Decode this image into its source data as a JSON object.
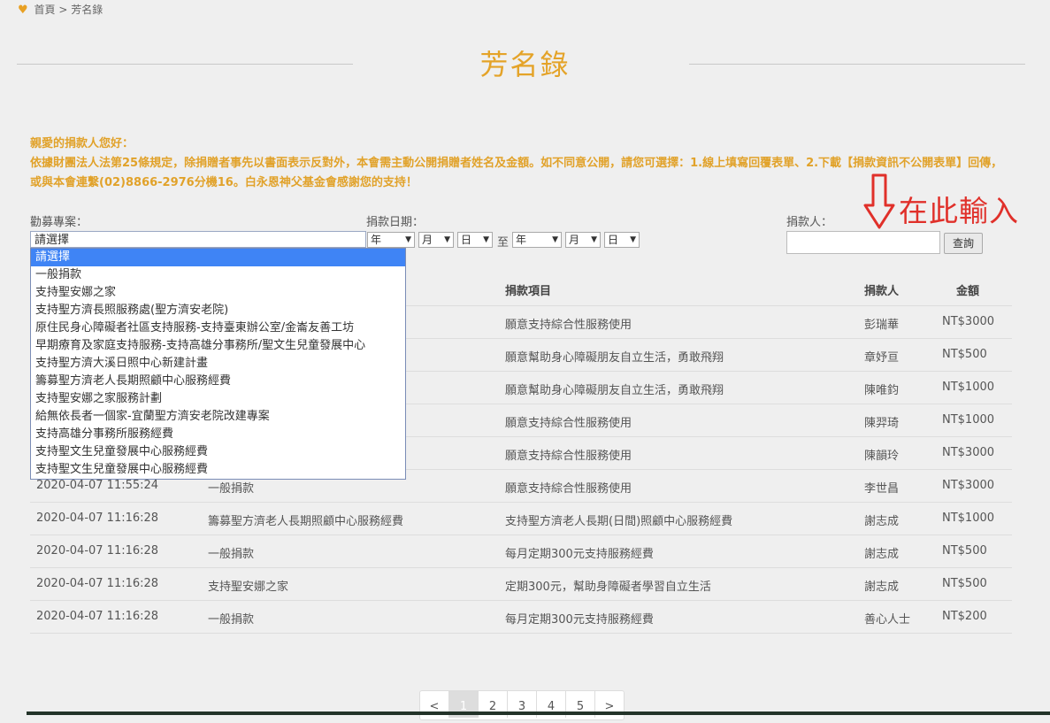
{
  "breadcrumb": {
    "home": "首頁",
    "sep": ">",
    "current": "芳名錄"
  },
  "page_title": "芳名錄",
  "notice": {
    "line1": "親愛的捐款人您好：",
    "line2_before": "依據財團法人法第25條規定，除捐贈者事先以書面表示反對外，本會需主動公開捐贈者姓名及金額。如不同意公開，請您可選擇：1.線上填寫回覆表單、",
    "line2_link": "2.下載",
    "line2_after": "【捐款資訊不公開表單】回傳，或與本會連繫(02)8866-2976分機16。白永恩神父基金會感謝您的支持！"
  },
  "filters": {
    "project_label": "勸募專案：",
    "project_selected": "請選擇",
    "date_label": "捐款日期：",
    "year": "年",
    "month": "月",
    "day": "日",
    "to": "至",
    "donor_label": "捐款人：",
    "query_button": "查詢"
  },
  "annotation": {
    "text": "在此輸入"
  },
  "dropdown_options": [
    "請選擇",
    "一般捐款",
    "支持聖安娜之家",
    "支持聖方濟長照服務處(聖方濟安老院)",
    "原住民身心障礙者社區支持服務-支持臺東辦公室/金崙友善工坊",
    "早期療育及家庭支持服務-支持高雄分事務所/聖文生兒童發展中心",
    "支持聖方濟大溪日照中心新建計畫",
    "籌募聖方濟老人長期照顧中心服務經費",
    "支持聖安娜之家服務計劃",
    "給無依長者一個家-宜蘭聖方濟安老院改建專案",
    "支持高雄分事務所服務經費",
    "支持聖文生兒童發展中心服務經費",
    "支持聖文生兒童發展中心服務經費"
  ],
  "table": {
    "headers": {
      "item": "捐款項目",
      "donor": "捐款人",
      "amount": "金額"
    },
    "rows": [
      {
        "date": "",
        "project": "",
        "item": "願意支持綜合性服務使用",
        "donor": "彭瑞華",
        "amount": "NT$3000"
      },
      {
        "date": "",
        "project": "",
        "item": "願意幫助身心障礙朋友自立生活，勇敢飛翔",
        "donor": "章妤亘",
        "amount": "NT$500"
      },
      {
        "date": "",
        "project": "",
        "item": "願意幫助身心障礙朋友自立生活，勇敢飛翔",
        "donor": "陳唯鈞",
        "amount": "NT$1000"
      },
      {
        "date": "",
        "project": "",
        "item": "願意支持綜合性服務使用",
        "donor": "陳羿琦",
        "amount": "NT$1000"
      },
      {
        "date": "",
        "project": "",
        "item": "願意支持綜合性服務使用",
        "donor": "陳韻玲",
        "amount": "NT$3000"
      },
      {
        "date": "2020-04-07 11:55:24",
        "project": "一般捐款",
        "item": "願意支持綜合性服務使用",
        "donor": "李世昌",
        "amount": "NT$3000"
      },
      {
        "date": "2020-04-07 11:16:28",
        "project": "籌募聖方濟老人長期照顧中心服務經費",
        "item": "支持聖方濟老人長期(日間)照顧中心服務經費",
        "donor": "謝志成",
        "amount": "NT$1000"
      },
      {
        "date": "2020-04-07 11:16:28",
        "project": "一般捐款",
        "item": "每月定期300元支持服務經費",
        "donor": "謝志成",
        "amount": "NT$500"
      },
      {
        "date": "2020-04-07 11:16:28",
        "project": "支持聖安娜之家",
        "item": "定期300元，幫助身障礙者學習自立生活",
        "donor": "謝志成",
        "amount": "NT$500"
      },
      {
        "date": "2020-04-07 11:16:28",
        "project": "一般捐款",
        "item": "每月定期300元支持服務經費",
        "donor": "善心人士",
        "amount": "NT$200"
      }
    ]
  },
  "pagination": {
    "prev": "<",
    "pages": [
      "1",
      "2",
      "3",
      "4",
      "5"
    ],
    "next": ">",
    "current": "1"
  },
  "colors": {
    "accent": "#e4a328",
    "annotation": "#e0302a",
    "dropdown_highlight": "#3f84f5"
  }
}
